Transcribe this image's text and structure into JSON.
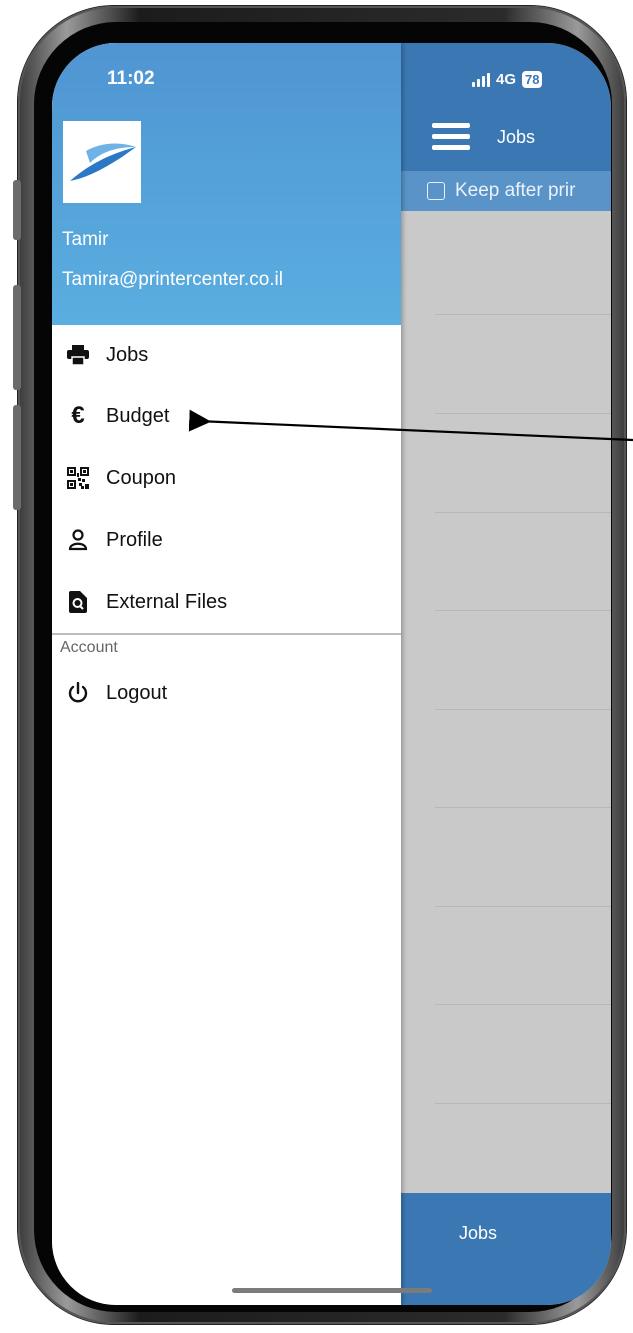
{
  "status_bar": {
    "time": "11:02",
    "network": "4G",
    "battery": "78"
  },
  "main": {
    "title": "Jobs",
    "keep_option": "Keep after prir",
    "bottom_tab": "Jobs"
  },
  "drawer": {
    "user_name": "Tamir",
    "user_email": "Tamira@printercenter.co.il",
    "items": [
      {
        "label": "Jobs",
        "icon": "printer-icon"
      },
      {
        "label": "Budget",
        "icon": "euro-icon"
      },
      {
        "label": "Coupon",
        "icon": "qr-code-icon"
      },
      {
        "label": "Profile",
        "icon": "user-icon"
      },
      {
        "label": "External Files",
        "icon": "file-search-icon"
      }
    ],
    "section_label": "Account",
    "account_items": [
      {
        "label": "Logout",
        "icon": "power-icon"
      }
    ]
  },
  "colors": {
    "header_blue": "#3b78b3",
    "drawer_header": "#4f95d2",
    "keep_bar": "#5a93c7"
  }
}
